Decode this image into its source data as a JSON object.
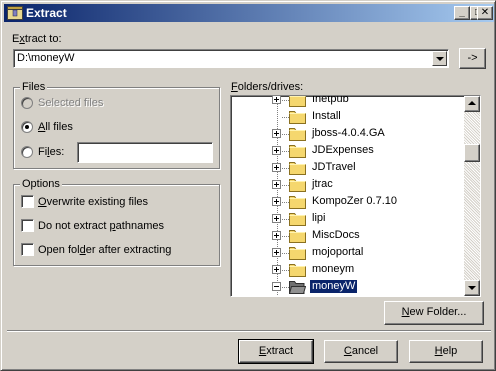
{
  "window": {
    "title": "Extract",
    "icon": "archive-icon",
    "controls": {
      "minimize": "_",
      "maximize": "□",
      "close": "✕"
    }
  },
  "extract_to": {
    "label_pre": "E",
    "label_u": "x",
    "label_post": "tract to:",
    "value": "D:\\moneyW",
    "browse_label": "->"
  },
  "files_group": {
    "title": "Files",
    "selected_files": "Selected files",
    "all_files_u": "A",
    "all_files_post": "ll files",
    "files_pre": "Fi",
    "files_u": "l",
    "files_post": "es:",
    "files_value": "",
    "selected": "all_files"
  },
  "options_group": {
    "title": "Options",
    "overwrite_u": "O",
    "overwrite_post": "verwrite existing files",
    "no_paths_pre": "Do not extract ",
    "no_paths_u": "p",
    "no_paths_post": "athnames",
    "open_folder_pre": "Open fol",
    "open_folder_u": "d",
    "open_folder_post": "er after extracting",
    "overwrite_checked": false,
    "no_paths_checked": false,
    "open_folder_checked": false
  },
  "tree": {
    "label_u": "F",
    "label_post": "olders/drives:",
    "items": [
      {
        "label": "Inetpub",
        "expander": "plus"
      },
      {
        "label": "Install",
        "expander": "none"
      },
      {
        "label": "jboss-4.0.4.GA",
        "expander": "plus"
      },
      {
        "label": "JDExpenses",
        "expander": "plus"
      },
      {
        "label": "JDTravel",
        "expander": "plus"
      },
      {
        "label": "jtrac",
        "expander": "plus"
      },
      {
        "label": "KompoZer 0.7.10",
        "expander": "plus"
      },
      {
        "label": "lipi",
        "expander": "plus"
      },
      {
        "label": "MiscDocs",
        "expander": "plus"
      },
      {
        "label": "mojoportal",
        "expander": "plus"
      },
      {
        "label": "moneym",
        "expander": "plus"
      },
      {
        "label": "moneyW",
        "expander": "minus",
        "selected": true
      }
    ]
  },
  "buttons": {
    "new_folder_u": "N",
    "new_folder_post": "ew Folder...",
    "extract_u": "E",
    "extract_post": "xtract",
    "cancel_u": "C",
    "cancel_post": "ancel",
    "help_u": "H",
    "help_post": "elp"
  },
  "colors": {
    "face": "#d4d0c8",
    "title_gradient_start": "#0a246a",
    "title_gradient_end": "#a6caf0",
    "selection": "#0a246a",
    "folder": "#f5d76e"
  }
}
